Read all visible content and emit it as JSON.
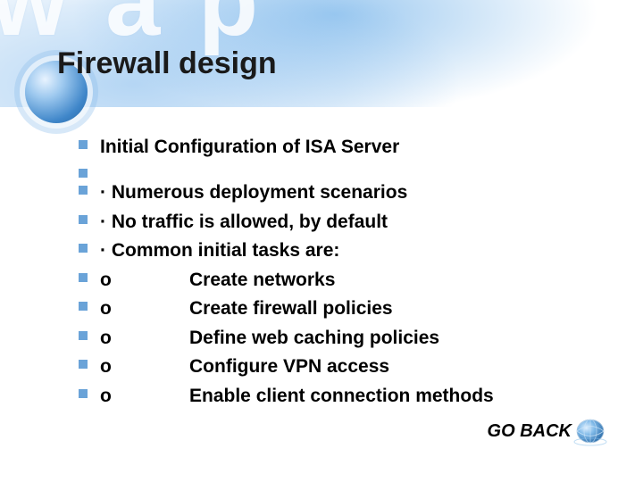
{
  "title": "Firewall design",
  "lines": [
    {
      "text": "Initial Configuration of ISA Server",
      "kind": "plain"
    },
    {
      "text": "",
      "kind": "plain"
    },
    {
      "text": "· Numerous deployment scenarios",
      "kind": "plain"
    },
    {
      "text": "· No traffic is allowed, by default",
      "kind": "plain"
    },
    {
      "text": "· Common initial tasks are:",
      "kind": "plain"
    },
    {
      "prefix": "o",
      "text": "Create networks",
      "kind": "sub"
    },
    {
      "prefix": "o",
      "text": "Create firewall policies",
      "kind": "sub"
    },
    {
      "prefix": "o",
      "text": "Define web caching policies",
      "kind": "sub"
    },
    {
      "prefix": "o",
      "text": "Configure VPN access",
      "kind": "sub"
    },
    {
      "prefix": "o",
      "text": "Enable client connection methods",
      "kind": "sub"
    }
  ],
  "goBack": {
    "label": "GO BACK"
  },
  "colors": {
    "bullet": "#6aa3d8",
    "accent": "#3f86c9"
  }
}
